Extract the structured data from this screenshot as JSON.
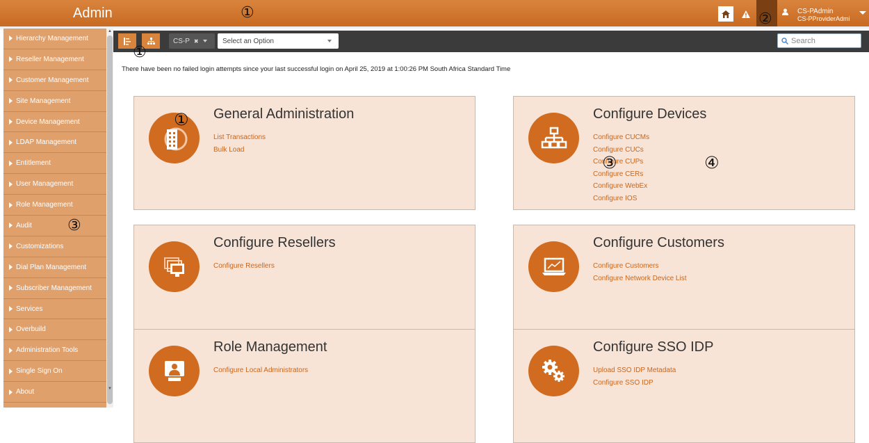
{
  "header": {
    "app_title": "Admin",
    "user_name": "CS-PAdmin",
    "user_role": "CS-PProviderAdmin",
    "icons": [
      "home-icon",
      "alert-icon",
      "user-icon",
      "chevron-down-icon"
    ]
  },
  "callouts": {
    "header": "①",
    "toolbar": "①",
    "user": "②",
    "sidebar": "③",
    "card_general": "①",
    "card_devices": "③",
    "devices_area": "④"
  },
  "sidebar": {
    "items": [
      {
        "label": "Hierarchy Management"
      },
      {
        "label": "Reseller Management"
      },
      {
        "label": "Customer Management"
      },
      {
        "label": "Site Management"
      },
      {
        "label": "Device Management"
      },
      {
        "label": "LDAP Management"
      },
      {
        "label": "Entitlement"
      },
      {
        "label": "User Management"
      },
      {
        "label": "Role Management"
      },
      {
        "label": "Audit"
      },
      {
        "label": "Customizations"
      },
      {
        "label": "Dial Plan Management"
      },
      {
        "label": "Subscriber Management"
      },
      {
        "label": "Services"
      },
      {
        "label": "Overbuild"
      },
      {
        "label": "Administration Tools"
      },
      {
        "label": "Single Sign On"
      },
      {
        "label": "About"
      }
    ],
    "collapse_label": "«"
  },
  "toolbar": {
    "chip_label": "CS-P",
    "chip_remove": "✖",
    "select_placeholder": "Select an Option",
    "search_placeholder": "Search"
  },
  "main": {
    "login_message": "There have been no failed login attempts since your last successful login on April 25, 2019 at 1:00:26 PM South Africa Standard Time",
    "cards": [
      {
        "title": "General Administration",
        "icon": "building-globe-icon",
        "links": [
          "List Transactions",
          "Bulk Load"
        ]
      },
      {
        "title": "Configure Devices",
        "icon": "network-icon",
        "links": [
          "Configure CUCMs",
          "Configure CUCs",
          "Configure CUPs",
          "Configure CERs",
          "Configure WebEx",
          "Configure IOS"
        ]
      },
      {
        "title": "Configure Resellers",
        "icon": "monitors-icon",
        "links": [
          "Configure Resellers"
        ]
      },
      {
        "title": "Configure Customers",
        "icon": "laptop-chart-icon",
        "links": [
          "Configure Customers",
          "Configure Network Device List"
        ]
      },
      {
        "title": "Role Management",
        "icon": "presenter-icon",
        "links": [
          "Configure Local Administrators"
        ]
      },
      {
        "title": "Configure SSO IDP",
        "icon": "gears-icon",
        "links": [
          "Upload SSO IDP Metadata",
          "Configure SSO IDP"
        ]
      }
    ]
  },
  "colors": {
    "accent": "#d06b1f",
    "card_bg": "#f8e4d7",
    "sidebar_bg": "#e0a06c",
    "toolbar_bg": "#3b3b3b"
  }
}
